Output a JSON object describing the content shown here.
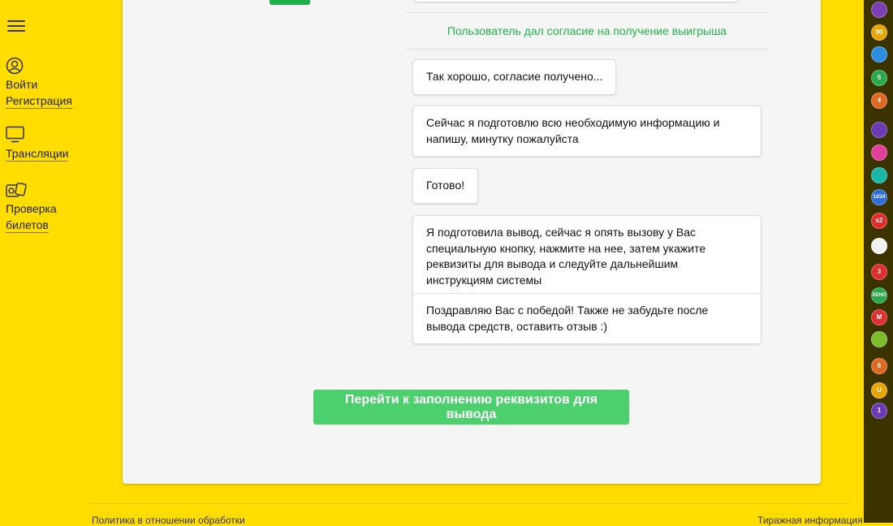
{
  "nav": {
    "login": "Войти",
    "register": "Регистрация",
    "broadcasts": "Трансляции",
    "check_tickets_line1": "Проверка",
    "check_tickets_line2": "билетов"
  },
  "chat": {
    "consent_notice": "Пользователь дал согласие на получение выигрыша",
    "messages": [
      "Так хорошо, согласие получено...",
      "Сейчас я подготовлю всю необходимую информацию и напишу, минутку пожалуйста",
      "Готово!",
      "Я подготовила вывод, сейчас я опять вызову у Вас специальную кнопку, нажмите на нее, затем укажите реквизиты для вывода и следуйте дальнейшим инструкциям системы",
      "Поздравляю Вас с победой! Также не забудьте после вывода средств, оставить отзыв :)"
    ]
  },
  "cta_label": "Перейти к заполнению реквизитов для вывода",
  "footer": {
    "privacy": "Политика в отношении обработки",
    "draw_info": "Тиражная информация"
  },
  "game_rail": {
    "icons": [
      {
        "name": "lottery-1-icon",
        "label": "",
        "color": "#7b3fb3"
      },
      {
        "name": "lottery-bingo-icon",
        "label": "90",
        "color": "#e8a400"
      },
      {
        "name": "lottery-rapido-icon",
        "label": "",
        "color": "#2b8de0"
      },
      {
        "name": "lottery-5x36-icon",
        "label": "5",
        "color": "#2aa84a"
      },
      {
        "name": "lottery-4x20-icon",
        "label": "4",
        "color": "#e0671f"
      },
      {
        "name": "lottery-gosloto-icon",
        "label": "",
        "color": "#6a3bb5"
      },
      {
        "name": "lottery-6x45-icon",
        "label": "",
        "color": "#e0409a"
      },
      {
        "name": "lottery-7x49-icon",
        "label": "",
        "color": "#19b7a8"
      },
      {
        "name": "lottery-12-24-icon",
        "label": "12/24",
        "color": "#2d6fd6"
      },
      {
        "name": "lottery-x2-icon",
        "label": "x2",
        "color": "#e02e2e"
      },
      {
        "name": "lottery-dice-icon",
        "label": "",
        "color": "#f2f2f2"
      },
      {
        "name": "lottery-top3-icon",
        "label": "3",
        "color": "#e02e2e"
      },
      {
        "name": "lottery-keno-icon",
        "label": "КЕНО",
        "color": "#2aa84a"
      },
      {
        "name": "lottery-matchball-icon",
        "label": "M",
        "color": "#e02e2e"
      },
      {
        "name": "lottery-zodiac-icon",
        "label": "",
        "color": "#7dbb2c"
      },
      {
        "name": "lottery-6-36-icon",
        "label": "6",
        "color": "#e0671f"
      },
      {
        "name": "lottery-horseshoe-icon",
        "label": "U",
        "color": "#e8a400"
      },
      {
        "name": "lottery-1-90-icon",
        "label": "1",
        "color": "#6a3bb5"
      }
    ]
  }
}
